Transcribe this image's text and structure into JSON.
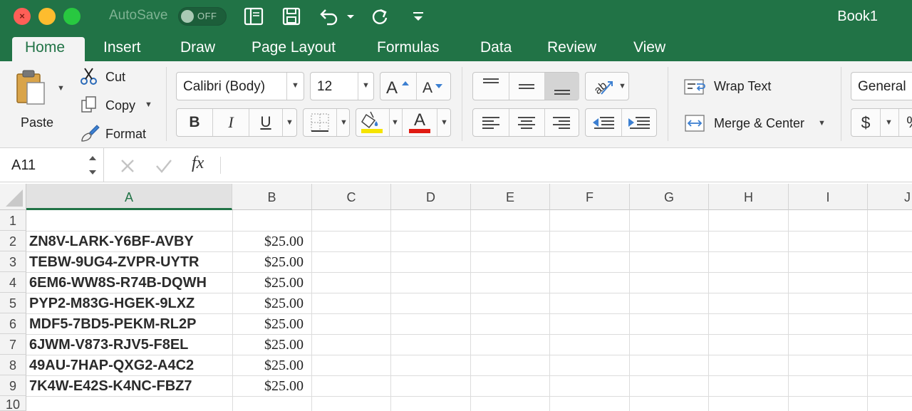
{
  "titlebar": {
    "autosave_label": "AutoSave",
    "autosave_state": "OFF",
    "doc_title": "Book1"
  },
  "tabs": [
    "Home",
    "Insert",
    "Draw",
    "Page Layout",
    "Formulas",
    "Data",
    "Review",
    "View"
  ],
  "active_tab": "Home",
  "ribbon": {
    "paste_label": "Paste",
    "cut_label": "Cut",
    "copy_label": "Copy",
    "format_label": "Format",
    "font_name": "Calibri (Body)",
    "font_size": "12",
    "bold_label": "B",
    "italic_label": "I",
    "underline_label": "U",
    "font_color_letter": "A",
    "fill_color": "#f5e400",
    "font_color": "#e01a12",
    "wrap_text_label": "Wrap Text",
    "merge_center_label": "Merge & Center",
    "number_format": "General",
    "currency_symbol": "$",
    "percent_symbol": "%"
  },
  "formula_bar": {
    "name_box": "A11",
    "fx_label": "fx"
  },
  "columns": [
    "A",
    "B",
    "C",
    "D",
    "E",
    "F",
    "G",
    "H",
    "I",
    "J"
  ],
  "selected_column": "A",
  "rows": [
    {
      "num": "1",
      "a": "",
      "b": ""
    },
    {
      "num": "2",
      "a": "ZN8V-LARK-Y6BF-AVBY",
      "b": "$25.00"
    },
    {
      "num": "3",
      "a": "TEBW-9UG4-ZVPR-UYTR",
      "b": "$25.00"
    },
    {
      "num": "4",
      "a": "6EM6-WW8S-R74B-DQWH",
      "b": "$25.00"
    },
    {
      "num": "5",
      "a": "PYP2-M83G-HGEK-9LXZ",
      "b": "$25.00"
    },
    {
      "num": "6",
      "a": "MDF5-7BD5-PEKM-RL2P",
      "b": "$25.00"
    },
    {
      "num": "7",
      "a": "6JWM-V873-RJV5-F8EL",
      "b": "$25.00"
    },
    {
      "num": "8",
      "a": "49AU-7HAP-QXG2-A4C2",
      "b": "$25.00"
    },
    {
      "num": "9",
      "a": "7K4W-E42S-K4NC-FBZ7",
      "b": "$25.00"
    },
    {
      "num": "10",
      "a": "",
      "b": ""
    }
  ],
  "colors": {
    "brand_green": "#217346",
    "close": "#fe5f57",
    "minimize": "#febc2e",
    "zoom": "#28c840"
  }
}
